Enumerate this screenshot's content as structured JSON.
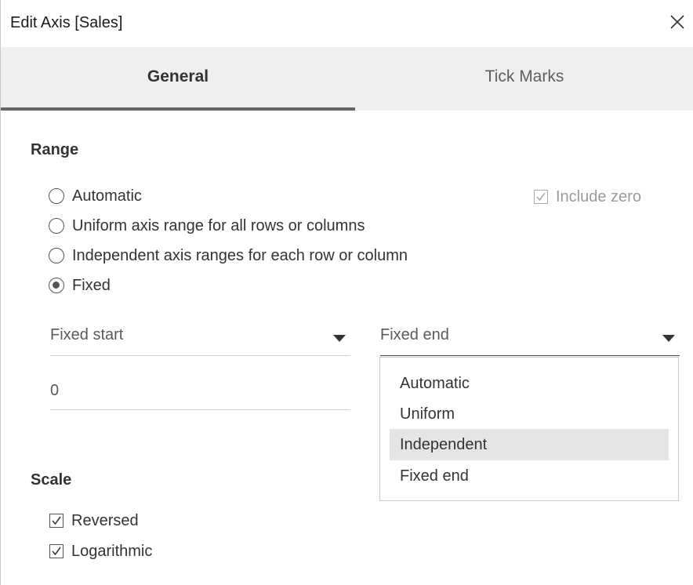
{
  "window": {
    "title": "Edit Axis [Sales]"
  },
  "tabs": [
    {
      "label": "General",
      "active": true
    },
    {
      "label": "Tick Marks",
      "active": false
    }
  ],
  "range": {
    "heading": "Range",
    "options": [
      {
        "label": "Automatic",
        "selected": false
      },
      {
        "label": "Uniform axis range for all rows or columns",
        "selected": false
      },
      {
        "label": "Independent axis ranges for each row or column",
        "selected": false
      },
      {
        "label": "Fixed",
        "selected": true
      }
    ],
    "include_zero": {
      "label": "Include zero",
      "checked": true,
      "disabled": true
    },
    "fixed_start": {
      "selected": "Fixed start",
      "value": "0"
    },
    "fixed_end": {
      "selected": "Fixed end",
      "menu_open": true,
      "options": [
        "Automatic",
        "Uniform",
        "Independent",
        "Fixed end"
      ],
      "highlighted": "Independent"
    }
  },
  "scale": {
    "heading": "Scale",
    "reversed": {
      "label": "Reversed",
      "checked": true
    },
    "logarithmic": {
      "label": "Logarithmic",
      "checked": true
    }
  },
  "icons": {
    "close": "close-icon",
    "dropdown": "triangle-down-icon",
    "check": "checkmark-icon"
  },
  "colors": {
    "tab_bar": "#efefef",
    "active_tab_underline": "#666666",
    "menu_highlight": "#e5e5e5"
  }
}
